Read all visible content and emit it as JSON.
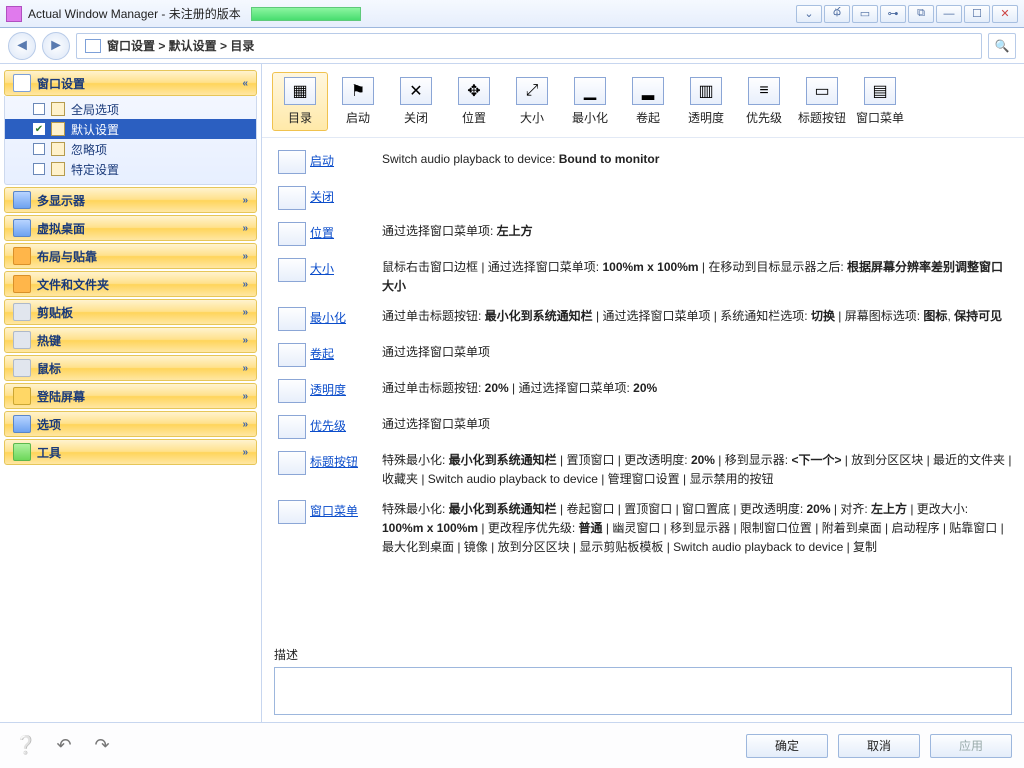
{
  "title": "Actual Window Manager - 未注册的版本",
  "breadcrumb": "窗口设置 > 默认设置 > 目录",
  "sidebar": {
    "groups": [
      {
        "label": "窗口设置",
        "expanded": true,
        "icon": "win",
        "items": [
          {
            "label": "全局选项",
            "checked": false,
            "selected": false
          },
          {
            "label": "默认设置",
            "checked": true,
            "selected": true
          },
          {
            "label": "忽略项",
            "checked": false,
            "selected": false
          },
          {
            "label": "特定设置",
            "checked": false,
            "selected": false
          }
        ]
      },
      {
        "label": "多显示器",
        "icon": "blue"
      },
      {
        "label": "虚拟桌面",
        "icon": "blue"
      },
      {
        "label": "布局与贴靠",
        "icon": "orange"
      },
      {
        "label": "文件和文件夹",
        "icon": "orange"
      },
      {
        "label": "剪贴板",
        "icon": "gray"
      },
      {
        "label": "热键",
        "icon": "gray"
      },
      {
        "label": "鼠标",
        "icon": "gray"
      },
      {
        "label": "登陆屏幕",
        "icon": "key"
      },
      {
        "label": "选项",
        "icon": "blue"
      },
      {
        "label": "工具",
        "icon": "green"
      }
    ]
  },
  "toolbar": [
    {
      "label": "目录",
      "glyph": "▦",
      "active": true
    },
    {
      "label": "启动",
      "glyph": "⚑"
    },
    {
      "label": "关闭",
      "glyph": "✕"
    },
    {
      "label": "位置",
      "glyph": "✥"
    },
    {
      "label": "大小",
      "glyph": "⤢"
    },
    {
      "label": "最小化",
      "glyph": "▁"
    },
    {
      "label": "卷起",
      "glyph": "▂"
    },
    {
      "label": "透明度",
      "glyph": "▥"
    },
    {
      "label": "优先级",
      "glyph": "≡"
    },
    {
      "label": "标题按钮",
      "glyph": "▭"
    },
    {
      "label": "窗口菜单",
      "glyph": "▤"
    }
  ],
  "summary": [
    {
      "link": "启动",
      "html": "Switch audio playback to device: <b>Bound to monitor</b>"
    },
    {
      "link": "关闭",
      "html": ""
    },
    {
      "link": "位置",
      "html": "通过选择窗口菜单项: <b>左上方</b>"
    },
    {
      "link": "大小",
      "html": "鼠标右击窗口边框 | 通过选择窗口菜单项: <b>100%m x 100%m</b> | 在移动到目标显示器之后: <b>根据屏幕分辨率差别调整窗口大小</b>"
    },
    {
      "link": "最小化",
      "html": "通过单击标题按钮: <b>最小化到系统通知栏</b> | 通过选择窗口菜单项 | 系统通知栏选项: <b>切换</b> | 屏幕图标选项: <b>图标</b>, <b>保持可见</b>"
    },
    {
      "link": "卷起",
      "html": "通过选择窗口菜单项"
    },
    {
      "link": "透明度",
      "html": "通过单击标题按钮: <b>20%</b> | 通过选择窗口菜单项: <b>20%</b>"
    },
    {
      "link": "优先级",
      "html": "通过选择窗口菜单项"
    },
    {
      "link": "标题按钮",
      "html": "特殊最小化: <b>最小化到系统通知栏</b> | 置顶窗口 | 更改透明度: <b>20%</b> | 移到显示器: <b>&lt;下一个&gt;</b> | 放到分区区块 | 最近的文件夹 | 收藏夹 | Switch audio playback to device | 管理窗口设置 | 显示禁用的按钮"
    },
    {
      "link": "窗口菜单",
      "html": "特殊最小化: <b>最小化到系统通知栏</b> | 卷起窗口 | 置顶窗口 | 窗口置底 | 更改透明度: <b>20%</b> | 对齐: <b>左上方</b> | 更改大小: <b>100%m x 100%m</b> | 更改程序优先级: <b>普通</b> | 幽灵窗口 | 移到显示器 | 限制窗口位置 | 附着到桌面 | 启动程序 | 贴靠窗口 | 最大化到桌面 | 镜像 | 放到分区区块 | 显示剪贴板模板 | Switch audio playback to device | 复制"
    }
  ],
  "desc_label": "描述",
  "buttons": {
    "ok": "确定",
    "cancel": "取消",
    "apply": "应用"
  }
}
